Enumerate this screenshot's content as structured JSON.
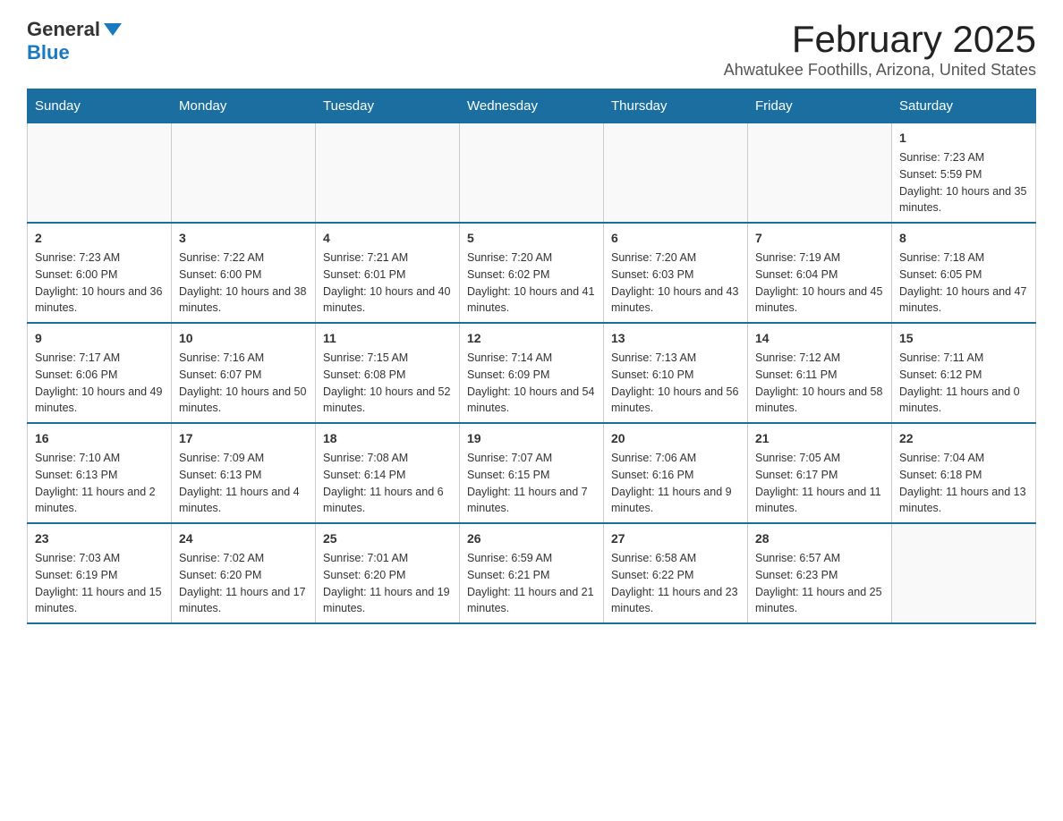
{
  "logo": {
    "general": "General",
    "blue": "Blue"
  },
  "title": "February 2025",
  "location": "Ahwatukee Foothills, Arizona, United States",
  "days_of_week": [
    "Sunday",
    "Monday",
    "Tuesday",
    "Wednesday",
    "Thursday",
    "Friday",
    "Saturday"
  ],
  "weeks": [
    [
      {
        "day": "",
        "sunrise": "",
        "sunset": "",
        "daylight": ""
      },
      {
        "day": "",
        "sunrise": "",
        "sunset": "",
        "daylight": ""
      },
      {
        "day": "",
        "sunrise": "",
        "sunset": "",
        "daylight": ""
      },
      {
        "day": "",
        "sunrise": "",
        "sunset": "",
        "daylight": ""
      },
      {
        "day": "",
        "sunrise": "",
        "sunset": "",
        "daylight": ""
      },
      {
        "day": "",
        "sunrise": "",
        "sunset": "",
        "daylight": ""
      },
      {
        "day": "1",
        "sunrise": "Sunrise: 7:23 AM",
        "sunset": "Sunset: 5:59 PM",
        "daylight": "Daylight: 10 hours and 35 minutes."
      }
    ],
    [
      {
        "day": "2",
        "sunrise": "Sunrise: 7:23 AM",
        "sunset": "Sunset: 6:00 PM",
        "daylight": "Daylight: 10 hours and 36 minutes."
      },
      {
        "day": "3",
        "sunrise": "Sunrise: 7:22 AM",
        "sunset": "Sunset: 6:00 PM",
        "daylight": "Daylight: 10 hours and 38 minutes."
      },
      {
        "day": "4",
        "sunrise": "Sunrise: 7:21 AM",
        "sunset": "Sunset: 6:01 PM",
        "daylight": "Daylight: 10 hours and 40 minutes."
      },
      {
        "day": "5",
        "sunrise": "Sunrise: 7:20 AM",
        "sunset": "Sunset: 6:02 PM",
        "daylight": "Daylight: 10 hours and 41 minutes."
      },
      {
        "day": "6",
        "sunrise": "Sunrise: 7:20 AM",
        "sunset": "Sunset: 6:03 PM",
        "daylight": "Daylight: 10 hours and 43 minutes."
      },
      {
        "day": "7",
        "sunrise": "Sunrise: 7:19 AM",
        "sunset": "Sunset: 6:04 PM",
        "daylight": "Daylight: 10 hours and 45 minutes."
      },
      {
        "day": "8",
        "sunrise": "Sunrise: 7:18 AM",
        "sunset": "Sunset: 6:05 PM",
        "daylight": "Daylight: 10 hours and 47 minutes."
      }
    ],
    [
      {
        "day": "9",
        "sunrise": "Sunrise: 7:17 AM",
        "sunset": "Sunset: 6:06 PM",
        "daylight": "Daylight: 10 hours and 49 minutes."
      },
      {
        "day": "10",
        "sunrise": "Sunrise: 7:16 AM",
        "sunset": "Sunset: 6:07 PM",
        "daylight": "Daylight: 10 hours and 50 minutes."
      },
      {
        "day": "11",
        "sunrise": "Sunrise: 7:15 AM",
        "sunset": "Sunset: 6:08 PM",
        "daylight": "Daylight: 10 hours and 52 minutes."
      },
      {
        "day": "12",
        "sunrise": "Sunrise: 7:14 AM",
        "sunset": "Sunset: 6:09 PM",
        "daylight": "Daylight: 10 hours and 54 minutes."
      },
      {
        "day": "13",
        "sunrise": "Sunrise: 7:13 AM",
        "sunset": "Sunset: 6:10 PM",
        "daylight": "Daylight: 10 hours and 56 minutes."
      },
      {
        "day": "14",
        "sunrise": "Sunrise: 7:12 AM",
        "sunset": "Sunset: 6:11 PM",
        "daylight": "Daylight: 10 hours and 58 minutes."
      },
      {
        "day": "15",
        "sunrise": "Sunrise: 7:11 AM",
        "sunset": "Sunset: 6:12 PM",
        "daylight": "Daylight: 11 hours and 0 minutes."
      }
    ],
    [
      {
        "day": "16",
        "sunrise": "Sunrise: 7:10 AM",
        "sunset": "Sunset: 6:13 PM",
        "daylight": "Daylight: 11 hours and 2 minutes."
      },
      {
        "day": "17",
        "sunrise": "Sunrise: 7:09 AM",
        "sunset": "Sunset: 6:13 PM",
        "daylight": "Daylight: 11 hours and 4 minutes."
      },
      {
        "day": "18",
        "sunrise": "Sunrise: 7:08 AM",
        "sunset": "Sunset: 6:14 PM",
        "daylight": "Daylight: 11 hours and 6 minutes."
      },
      {
        "day": "19",
        "sunrise": "Sunrise: 7:07 AM",
        "sunset": "Sunset: 6:15 PM",
        "daylight": "Daylight: 11 hours and 7 minutes."
      },
      {
        "day": "20",
        "sunrise": "Sunrise: 7:06 AM",
        "sunset": "Sunset: 6:16 PM",
        "daylight": "Daylight: 11 hours and 9 minutes."
      },
      {
        "day": "21",
        "sunrise": "Sunrise: 7:05 AM",
        "sunset": "Sunset: 6:17 PM",
        "daylight": "Daylight: 11 hours and 11 minutes."
      },
      {
        "day": "22",
        "sunrise": "Sunrise: 7:04 AM",
        "sunset": "Sunset: 6:18 PM",
        "daylight": "Daylight: 11 hours and 13 minutes."
      }
    ],
    [
      {
        "day": "23",
        "sunrise": "Sunrise: 7:03 AM",
        "sunset": "Sunset: 6:19 PM",
        "daylight": "Daylight: 11 hours and 15 minutes."
      },
      {
        "day": "24",
        "sunrise": "Sunrise: 7:02 AM",
        "sunset": "Sunset: 6:20 PM",
        "daylight": "Daylight: 11 hours and 17 minutes."
      },
      {
        "day": "25",
        "sunrise": "Sunrise: 7:01 AM",
        "sunset": "Sunset: 6:20 PM",
        "daylight": "Daylight: 11 hours and 19 minutes."
      },
      {
        "day": "26",
        "sunrise": "Sunrise: 6:59 AM",
        "sunset": "Sunset: 6:21 PM",
        "daylight": "Daylight: 11 hours and 21 minutes."
      },
      {
        "day": "27",
        "sunrise": "Sunrise: 6:58 AM",
        "sunset": "Sunset: 6:22 PM",
        "daylight": "Daylight: 11 hours and 23 minutes."
      },
      {
        "day": "28",
        "sunrise": "Sunrise: 6:57 AM",
        "sunset": "Sunset: 6:23 PM",
        "daylight": "Daylight: 11 hours and 25 minutes."
      },
      {
        "day": "",
        "sunrise": "",
        "sunset": "",
        "daylight": ""
      }
    ]
  ]
}
